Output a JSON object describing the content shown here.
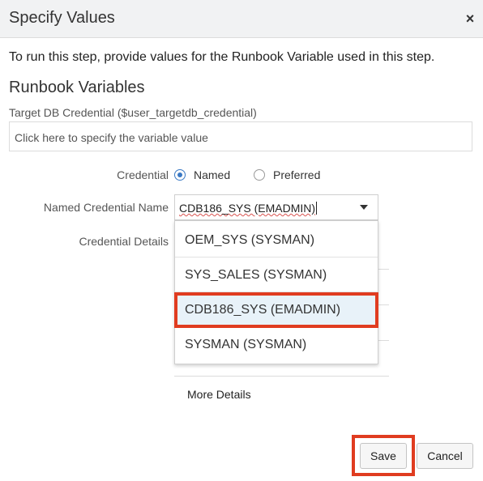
{
  "dialog": {
    "title": "Specify Values",
    "close_icon": "close-icon",
    "intro": "To run this step, provide values for the Runbook Variable used in this step.",
    "section_title": "Runbook Variables"
  },
  "variable": {
    "label": "Target DB Credential ($user_targetdb_credential)",
    "placeholder": "Click here to specify the variable value"
  },
  "credential": {
    "label": "Credential",
    "options": [
      {
        "label": "Named",
        "checked": true
      },
      {
        "label": "Preferred",
        "checked": false
      }
    ]
  },
  "named_credential": {
    "label": "Named Credential Name",
    "value": "CDB186_SYS (EMADMIN)",
    "dropdown_options": [
      "OEM_SYS (SYSMAN)",
      "SYS_SALES (SYSMAN)",
      "CDB186_SYS (EMADMIN)",
      "SYSMAN (SYSMAN)"
    ],
    "selected_index": 2
  },
  "credential_details": {
    "label": "Credential Details",
    "more_details": "More Details"
  },
  "buttons": {
    "save": "Save",
    "cancel": "Cancel"
  },
  "colors": {
    "highlight": "#e03c20",
    "accent": "#3a79c4",
    "selected_bg": "#e8f2f9"
  }
}
